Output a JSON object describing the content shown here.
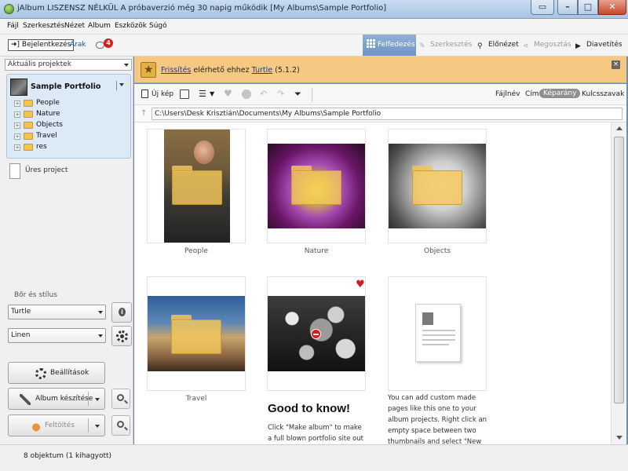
{
  "window": {
    "title": "jAlbum LISZENSZ NÉLKÜL A próbaverzió még 30 napig működik [My Albums\\Sample Portfolio]",
    "restore_icon": "window-icon",
    "minimize_icon": "minimize-icon",
    "maximize_icon": "maximize-icon",
    "close_icon": "close-icon"
  },
  "menu": [
    "Fájl",
    "Szerkesztés",
    "Nézet",
    "Album",
    "Eszközök",
    "Súgó"
  ],
  "toolbar": {
    "login_label": "Bejelentkezés",
    "prices_label": "Árak",
    "notification_count": "4",
    "modes": [
      {
        "label": "Felfedezés",
        "icon": "grid-icon",
        "state": "active"
      },
      {
        "label": "Szerkesztés",
        "icon": "pencil-icon",
        "state": "disabled"
      },
      {
        "label": "Előnézet",
        "icon": "magnifier-icon",
        "state": "normal"
      },
      {
        "label": "Megosztás",
        "icon": "share-icon",
        "state": "disabled"
      },
      {
        "label": "Diavetítés",
        "icon": "play-icon",
        "state": "normal"
      }
    ]
  },
  "sidebar": {
    "current_projects_label": "Aktuális projektek",
    "project_name": "Sample Portfolio",
    "folders": [
      "People",
      "Nature",
      "Objects",
      "Travel",
      "res"
    ],
    "empty_project_label": "Üres project",
    "skin_label": "Bőr és stílus",
    "skin_value": "Turtle",
    "style_value": "Linen",
    "settings_button": "Beállítások",
    "make_album_button": "Album készítése",
    "upload_button": "Feltöltés"
  },
  "notice": {
    "link1": "Frissítés",
    "text1": " elérhető ehhez ",
    "link2": "Turtle",
    "text2": " (5.1.2)",
    "close_symbol": "×",
    "accent_color": "#f5c981"
  },
  "edit_toolbar": {
    "new_label": "Új kép",
    "sort_tabs": [
      {
        "label": "Fájlnév",
        "active": false
      },
      {
        "label": "Cím",
        "active": false
      },
      {
        "label": "Képarány",
        "active": true
      },
      {
        "label": "Kulcsszavak",
        "active": false
      }
    ]
  },
  "path": {
    "value": "C:\\Users\\Desk Krisztián\\Documents\\My Albums\\Sample Portfolio"
  },
  "gallery": {
    "tiles": [
      {
        "caption": "People",
        "kind": "folder"
      },
      {
        "caption": "Nature",
        "kind": "folder"
      },
      {
        "caption": "Objects",
        "kind": "folder"
      },
      {
        "caption": "Travel",
        "kind": "folder"
      },
      {
        "caption": "",
        "kind": "excluded-image"
      },
      {
        "caption": "",
        "kind": "custom-page"
      }
    ],
    "good_to_know_title": "Good to know!",
    "good_to_know_body": "Click \"Make album\" to make a full blown portfolio site out of this",
    "custom_page_body": "You can add custom made pages like this one to your album projects. Right click an empty space between two thumbnails and select \"New page\" to create"
  },
  "status": {
    "text": "8 objektum (1 kihagyott)"
  }
}
